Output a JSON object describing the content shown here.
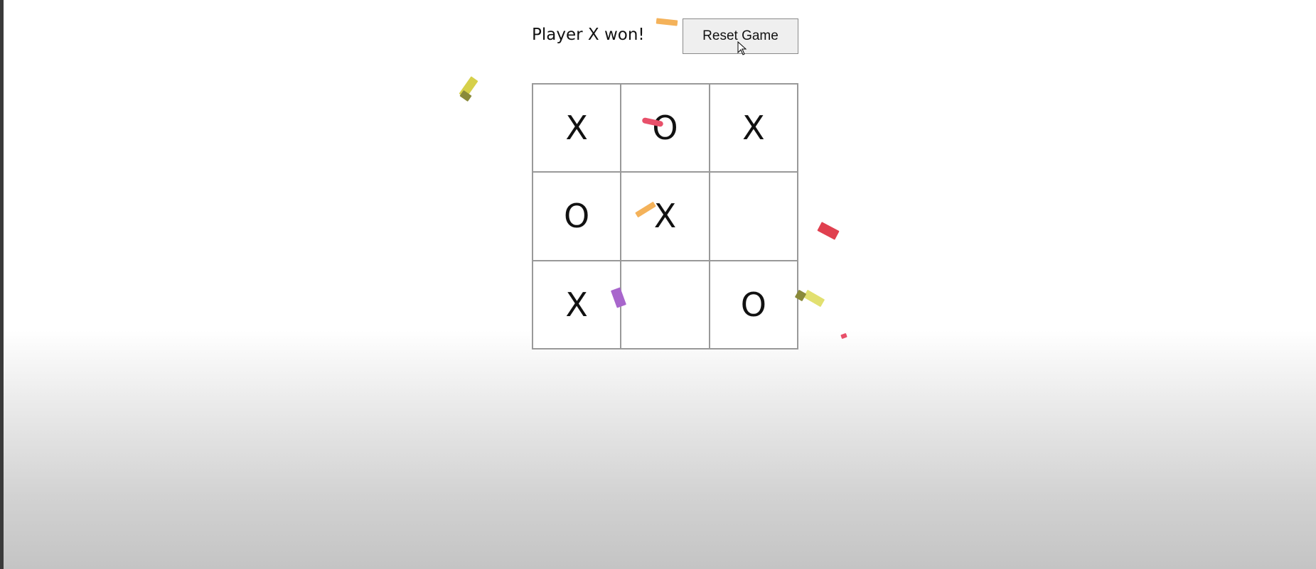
{
  "game": {
    "status_text": "Player X won!",
    "reset_label": "Reset Game",
    "winner": "X"
  },
  "board": {
    "cells": [
      "X",
      "O",
      "X",
      "O",
      "X",
      "",
      "X",
      "",
      "O"
    ]
  },
  "confetti_colors": [
    "#f4b25a",
    "#d6d04a",
    "#8a8a3a",
    "#e8506a",
    "#a866cc",
    "#e2e070",
    "#e0404f"
  ]
}
